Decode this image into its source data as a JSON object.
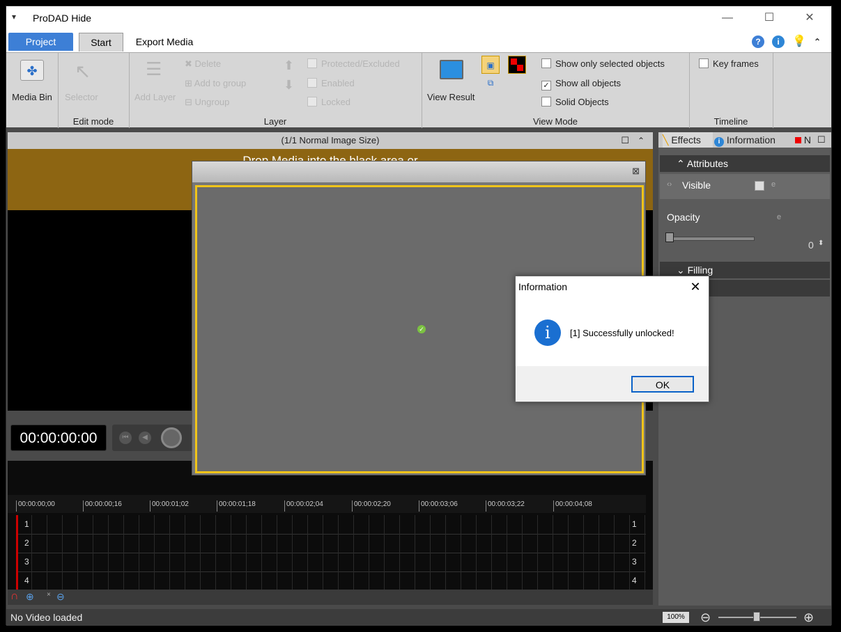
{
  "window": {
    "title": "ProDAD Hide",
    "sysmenu_glyph": "▾",
    "minimize": "—",
    "maximize": "☐",
    "close": "✕"
  },
  "tabs": [
    {
      "label": "Project"
    },
    {
      "label": "Start"
    },
    {
      "label": "Export Media"
    }
  ],
  "ribbon": {
    "media_bin": "Media Bin",
    "selector": "Selector",
    "edit_mode_group": "Edit mode",
    "add_layer": "Add Layer",
    "delete": "Delete",
    "add_to_group": "Add to group",
    "ungroup": "Ungroup",
    "protected_excluded": "Protected/Excluded",
    "enabled": "Enabled",
    "locked": "Locked",
    "layer_group": "Layer",
    "view_result": "View Result",
    "show_only_selected": "Show only selected objects",
    "show_all_objects": "Show all objects",
    "solid_objects": "Solid Objects",
    "view_mode_group": "View Mode",
    "key_frames": "Key frames",
    "timeline_group": "Timeline"
  },
  "preview": {
    "header": "(1/1  Normal Image Size)",
    "drop_text": "Drop Media into the black area or"
  },
  "right_panel": {
    "tab_effects": "Effects",
    "tab_information": "Information",
    "tab_third": "N",
    "attributes": "Attributes",
    "visible": "Visible",
    "opacity": "Opacity",
    "opacity_value": "0",
    "filling": "Filling"
  },
  "transport": {
    "timecode": "00:00:00:00"
  },
  "timeline": {
    "ticks": [
      "00:00:00;00",
      "00:00:00;16",
      "00:00:01;02",
      "00:00:01;18",
      "00:00:02;04",
      "00:00:02;20",
      "00:00:03;06",
      "00:00:03;22",
      "00:00:04;08"
    ],
    "tracks": [
      "1",
      "2",
      "3",
      "4"
    ]
  },
  "status": {
    "text": "No Video loaded",
    "zoom": "100%"
  },
  "dialog": {
    "title": "Information",
    "message": "[1] Successfully unlocked!",
    "ok": "OK",
    "icon_glyph": "i",
    "close_glyph": "✕"
  }
}
